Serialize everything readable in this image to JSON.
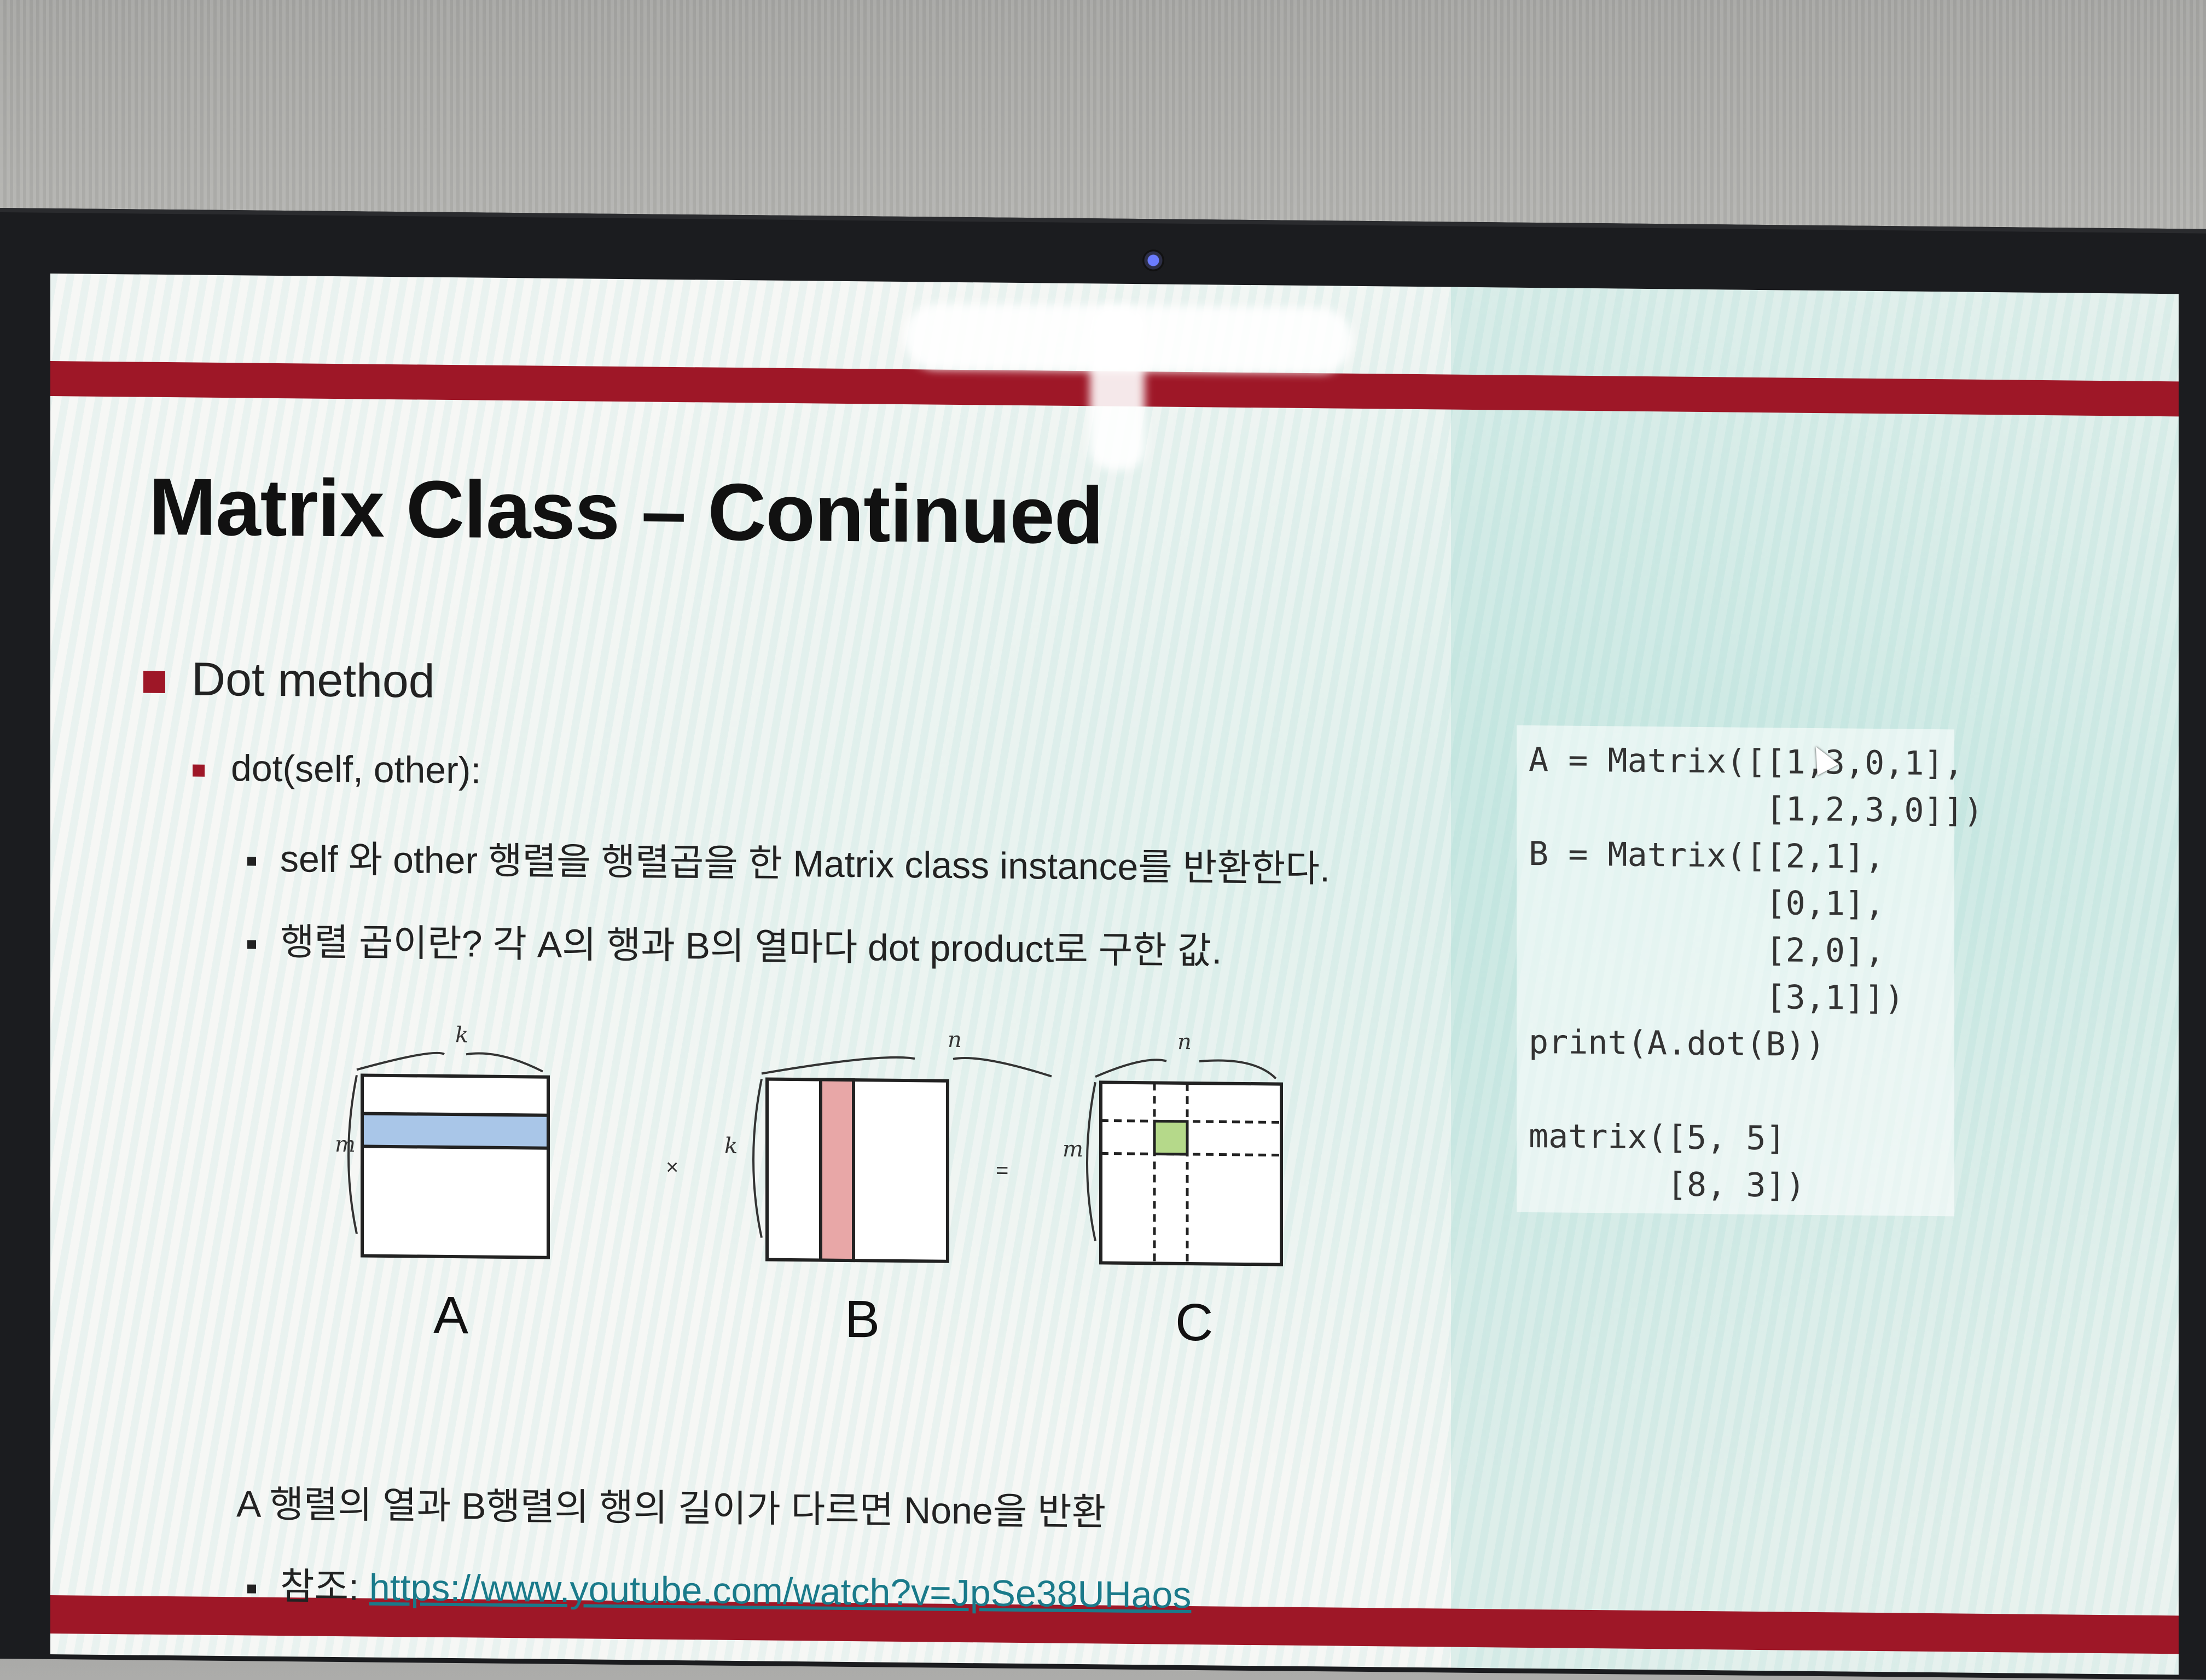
{
  "slide": {
    "title": "Matrix Class – Continued",
    "bullet1": "Dot method",
    "bullet2": "dot(self, other):",
    "bullet3a": "self 와 other 행렬을 행렬곱을 한 Matrix class instance를 반환한다.",
    "bullet3b": "행렬 곱이란? 각 A의 행과 B의 열마다 dot product로 구한 값.",
    "note": "A 행렬의 열과 B행렬의 행의 길이가 다르면 None을 반환",
    "ref_label": "참조: ",
    "ref_link": "https://www.youtube.com/watch?v=JpSe38UHaos"
  },
  "diagram": {
    "matrices": [
      {
        "label": "A",
        "top": "k",
        "side": "m",
        "highlight": "row",
        "color": "#a9c6e8"
      },
      {
        "label": "B",
        "top": "n",
        "side": "k",
        "highlight": "column",
        "color": "#e8a7a7"
      },
      {
        "label": "C",
        "top": "n",
        "side": "m",
        "highlight": "cell",
        "color": "#b5d98a"
      }
    ],
    "times": "×",
    "equals": "="
  },
  "code": {
    "lines": [
      "A = Matrix([[1,3,0,1],",
      "            [1,2,3,0]])",
      "B = Matrix([[2,1],",
      "            [0,1],",
      "            [2,0],",
      "            [3,1]])",
      "print(A.dot(B))",
      "",
      "matrix([5, 5]",
      "       [8, 3])"
    ]
  },
  "colors": {
    "accent": "#9e1727",
    "link": "#1a7a8a"
  }
}
